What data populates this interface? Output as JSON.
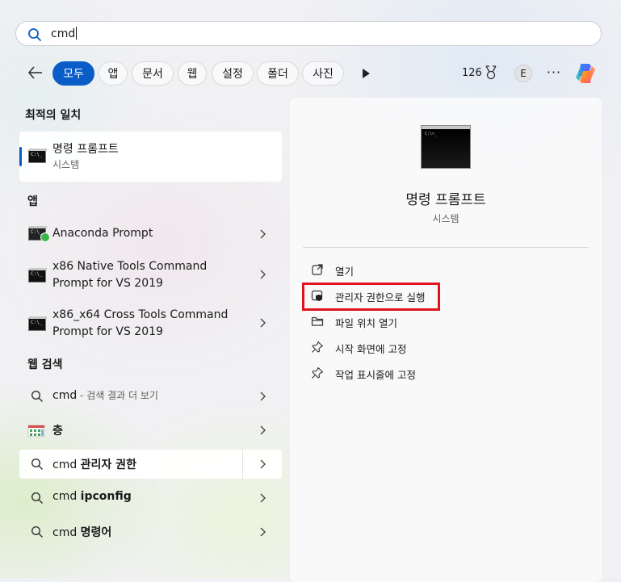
{
  "search": {
    "query": "cmd"
  },
  "filters": [
    "모두",
    "앱",
    "문서",
    "웹",
    "설정",
    "폴더",
    "사진"
  ],
  "toolbar": {
    "points": "126",
    "avatar_initial": "E",
    "more": "···"
  },
  "best_match": {
    "heading": "최적의 일치",
    "title": "명령 프롬프트",
    "subtitle": "시스템"
  },
  "apps": {
    "heading": "앱",
    "items": [
      {
        "line1": "Anaconda Prompt",
        "line2": ""
      },
      {
        "line1": "x86 Native Tools Command",
        "line2": "Prompt for VS 2019"
      },
      {
        "line1": "x86_x64 Cross Tools Command",
        "line2": "Prompt for VS 2019"
      }
    ]
  },
  "web": {
    "heading": "웹 검색",
    "items": [
      {
        "prefix": "cmd",
        "bold": "",
        "suffix": " - 검색 결과 더 보기"
      },
      {
        "prefix": "",
        "bold": "",
        "suffix": "",
        "label": "층"
      },
      {
        "prefix": "cmd ",
        "bold": "관리자 권한",
        "suffix": ""
      },
      {
        "prefix": "cmd ",
        "bold": "ipconfig",
        "suffix": ""
      },
      {
        "prefix": "cmd ",
        "bold": "명령어",
        "suffix": ""
      }
    ]
  },
  "detail": {
    "title": "명령 프롬프트",
    "subtitle": "시스템",
    "actions": [
      {
        "label": "열기",
        "icon": "open-external-icon"
      },
      {
        "label": "관리자 권한으로 실행",
        "icon": "shield-admin-icon"
      },
      {
        "label": "파일 위치 열기",
        "icon": "folder-icon"
      },
      {
        "label": "시작 화면에 고정",
        "icon": "pin-icon"
      },
      {
        "label": "작업 표시줄에 고정",
        "icon": "pin-icon"
      }
    ]
  },
  "colors": {
    "accent": "#0a5cc7",
    "highlight": "#e0141e"
  }
}
